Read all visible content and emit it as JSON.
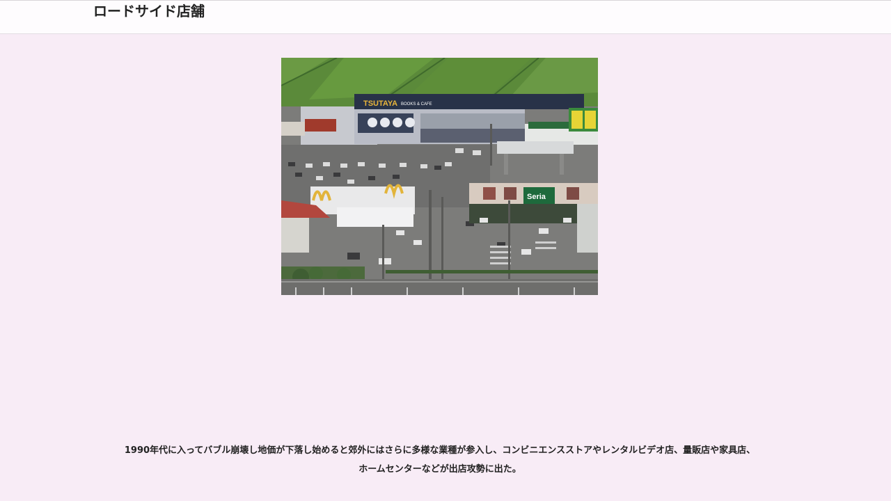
{
  "header": {
    "title": "ロードサイド店舗"
  },
  "photo": {
    "signs": {
      "tsutaya": "TSUTAYA",
      "books_cafe": "BOOKS & CAFE",
      "seria": "Seria"
    },
    "colors": {
      "field": "#5b8a3a",
      "sky": "#6f7f62",
      "asphalt": "#7c7c7a",
      "tsutaya_fascia": "#283248",
      "tsutaya_yellow": "#e9b53b",
      "seria_green": "#1e6a3c"
    }
  },
  "caption": {
    "line1": "1990年代に入ってバブル崩壊し地価が下落し始めると郊外にはさらに多様な業種が参入し、コンビニエンスストアやレンタルビデオ店、量販店や家具店、",
    "line2": "ホームセンターなどが出店攻勢に出た。"
  }
}
